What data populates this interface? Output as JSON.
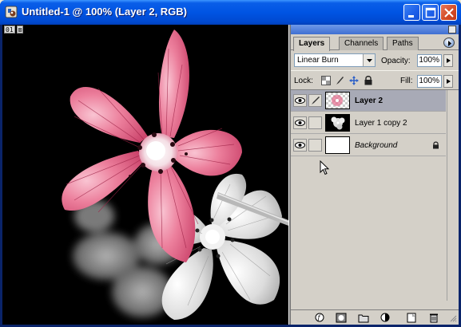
{
  "window": {
    "title": "Untitled-1 @ 100% (Layer 2, RGB)",
    "icons": [
      "photoshop-app-icon",
      "minimize-icon",
      "maximize-icon",
      "close-icon"
    ]
  },
  "document": {
    "badges": [
      "01",
      "⊠"
    ]
  },
  "palette": {
    "tabs": [
      {
        "label": "Layers",
        "active": true
      },
      {
        "label": "Channels",
        "active": false
      },
      {
        "label": "Paths",
        "active": false
      }
    ],
    "blend_mode": "Linear Burn",
    "opacity_label": "Opacity:",
    "opacity_value": "100%",
    "lock_label": "Lock:",
    "fill_label": "Fill:",
    "fill_value": "100%",
    "layers": [
      {
        "name": "Layer 2",
        "visible": true,
        "selected": true,
        "italic": false,
        "locked": false
      },
      {
        "name": "Layer 1 copy 2",
        "visible": true,
        "selected": false,
        "italic": false,
        "locked": false
      },
      {
        "name": "Background",
        "visible": true,
        "selected": false,
        "italic": true,
        "locked": true
      }
    ],
    "footer_icons": [
      "layer-style-icon",
      "layer-mask-icon",
      "new-set-icon",
      "adjustment-layer-icon",
      "new-layer-icon",
      "trash-icon"
    ]
  },
  "colors": {
    "titlebar": "#0054e3",
    "flower_pink": "#e46a8c",
    "canvas_bg": "#000000",
    "selected_layer": "#a8aab6"
  }
}
